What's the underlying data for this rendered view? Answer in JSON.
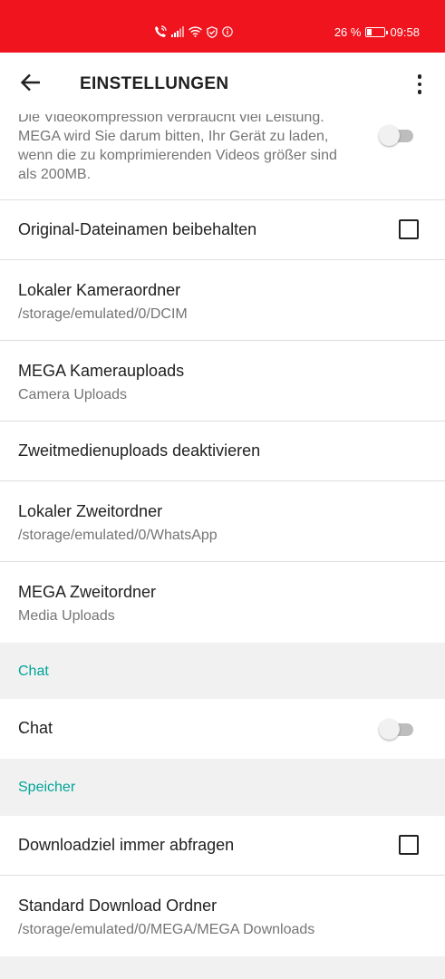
{
  "status_bar": {
    "battery_percent": "26 %",
    "battery_level": 0.26,
    "time": "09:58",
    "icons": [
      "wifi-call-icon",
      "signal-icon",
      "wifi-icon",
      "vpn-shield-icon",
      "info-circle-icon",
      "battery-icon"
    ]
  },
  "toolbar": {
    "title": "EINSTELLUNGEN",
    "back_icon": "arrow-back-icon",
    "menu_icon": "more-vert-icon"
  },
  "top_item": {
    "description": "Die Videokompression verbraucht viel Leistung. MEGA wird Sie darum bitten, Ihr Gerät zu laden, wenn die zu komprimierenden Videos größer sind als 200MB.",
    "switch_on": false
  },
  "items": {
    "keep_filenames": {
      "title": "Original-Dateinamen beibehalten",
      "checked": false
    },
    "local_camera_folder": {
      "title": "Lokaler Kameraordner",
      "subtitle": "/storage/emulated/0/DCIM"
    },
    "mega_camera_uploads": {
      "title": "MEGA Kamerauploads",
      "subtitle": "Camera Uploads"
    },
    "disable_secondary": {
      "title": "Zweitmedienuploads deaktivieren"
    },
    "local_secondary_folder": {
      "title": "Lokaler Zweitordner",
      "subtitle": "/storage/emulated/0/WhatsApp"
    },
    "mega_secondary_folder": {
      "title": "MEGA Zweitordner",
      "subtitle": "Media Uploads"
    },
    "chat": {
      "title": "Chat",
      "switch_on": false
    },
    "ask_download_location": {
      "title": "Downloadziel immer abfragen",
      "checked": false
    },
    "default_download_folder": {
      "title": "Standard Download Ordner",
      "subtitle": "/storage/emulated/0/MEGA/MEGA Downloads"
    }
  },
  "sections": {
    "chat": "Chat",
    "storage": "Speicher"
  },
  "colors": {
    "status_bar": "#f0141e",
    "accent": "#00a59a",
    "section_bg": "#f1f1f1",
    "divider": "#dedede"
  }
}
